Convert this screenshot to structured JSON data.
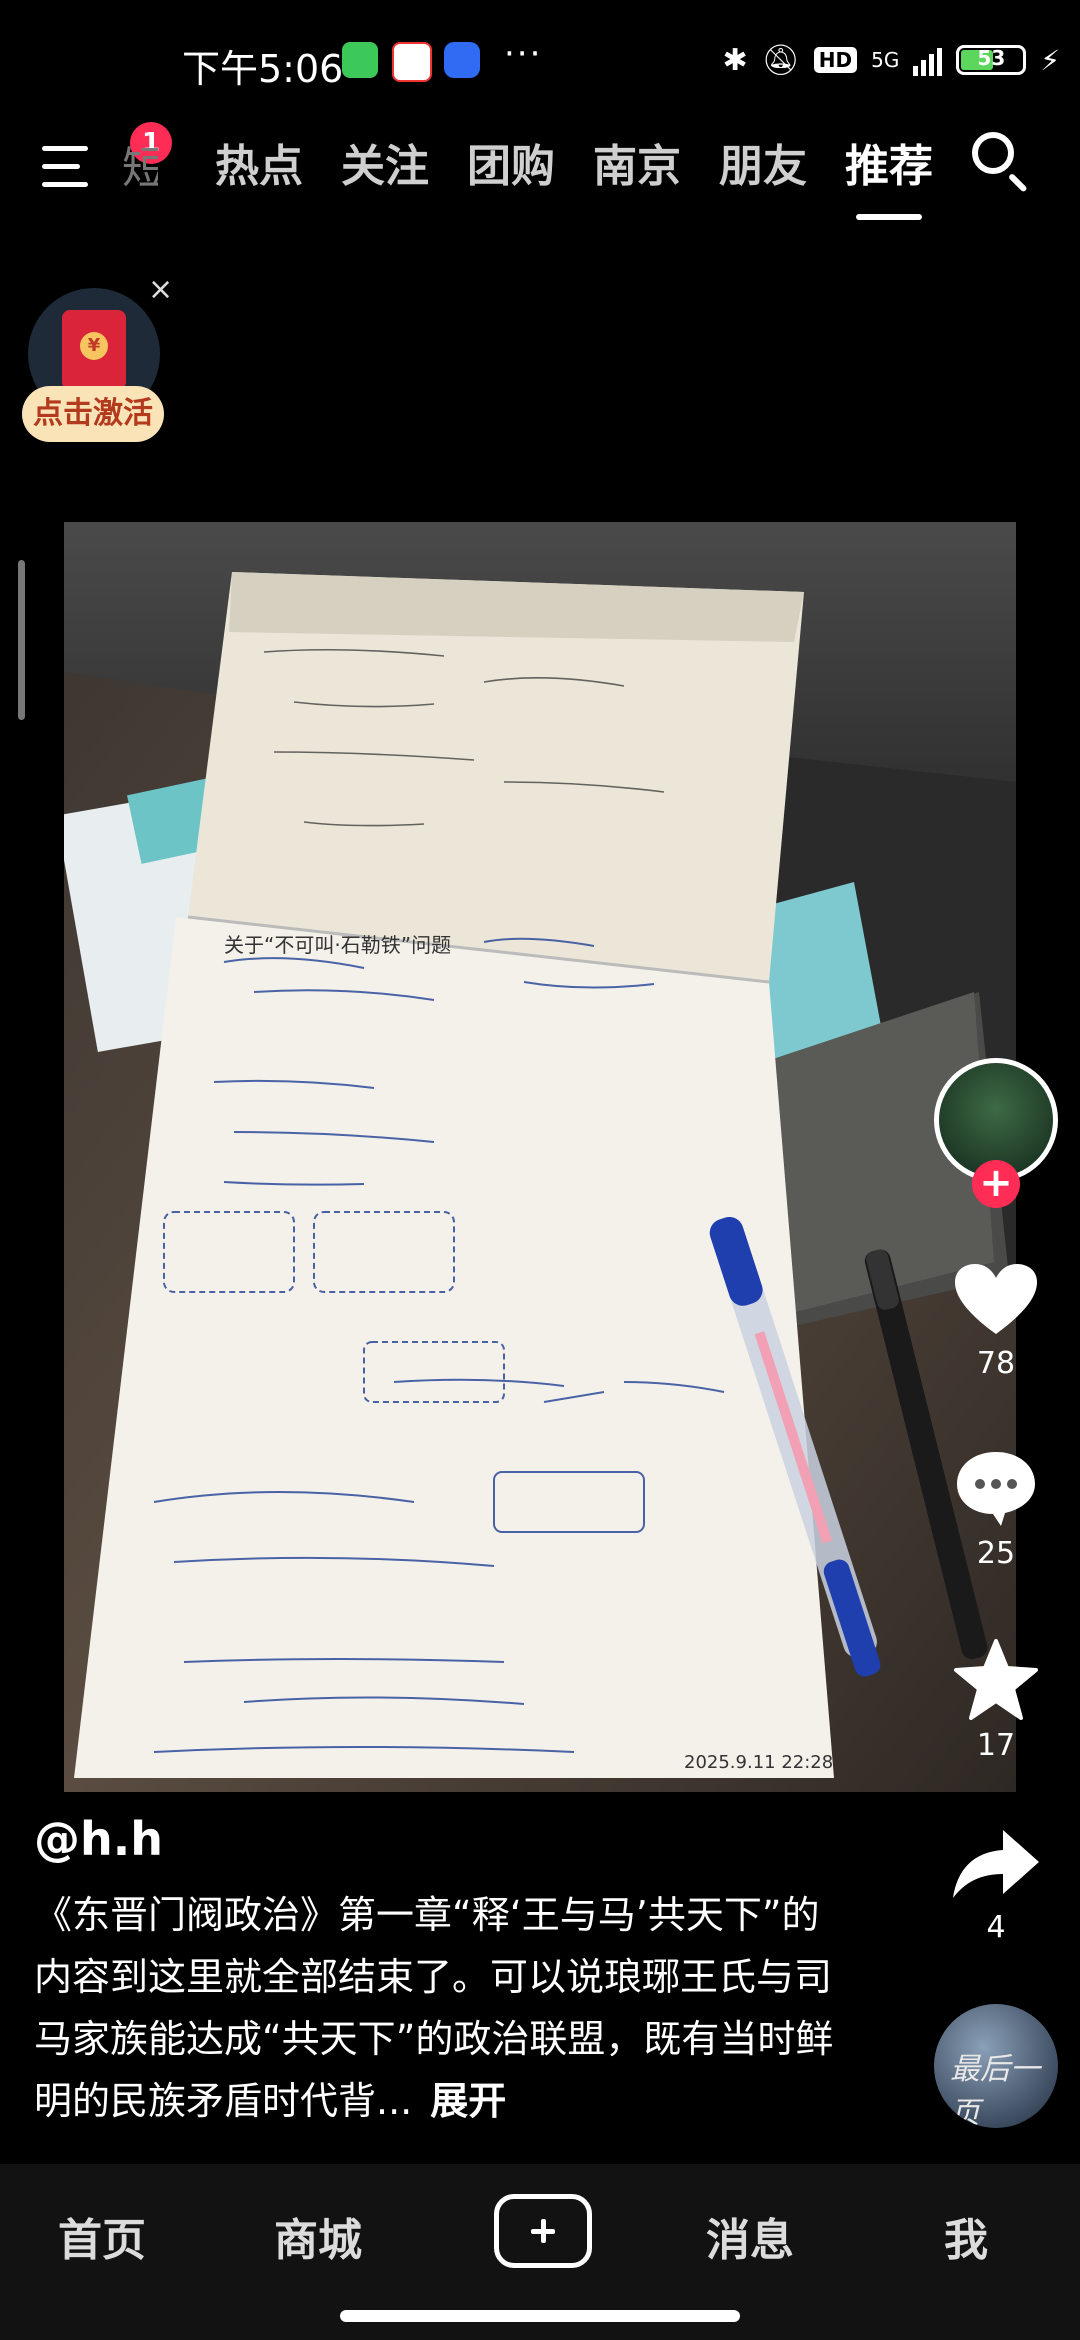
{
  "status_bar": {
    "time": "下午5:06",
    "more_dots": "···",
    "network": "5G",
    "hd": "HD",
    "battery": "53",
    "battery_level_percent": 53,
    "icons": [
      "wechat-icon",
      "58-app-icon",
      "baidu-netdisk-icon",
      "bluetooth-icon",
      "bell-muted-icon",
      "signal-icon",
      "charging-icon"
    ]
  },
  "top_nav": {
    "menu_badge": "1",
    "partial_tab": "短",
    "tabs": [
      {
        "label": "热点",
        "active": false
      },
      {
        "label": "关注",
        "active": false
      },
      {
        "label": "团购",
        "active": false
      },
      {
        "label": "南京",
        "active": false
      },
      {
        "label": "朋友",
        "active": false
      },
      {
        "label": "推荐",
        "active": true
      }
    ]
  },
  "red_envelope": {
    "close_label": "×",
    "button_label": "点击激活"
  },
  "photo": {
    "header_note": "关于“不可叫·石勒铁”问题",
    "date_note": "2025.9.11 22:28"
  },
  "actions": {
    "like_count": "78",
    "comment_count": "25",
    "favorite_count": "17",
    "share_count": "4",
    "follow_label": "+",
    "author_avatar_text": "最后一页"
  },
  "post": {
    "username": "@h.h",
    "caption": "《东晋门阀政治》第一章“释‘王与马’共天下”的内容到这里就全部结束了。可以说琅琊王氏与司马家族能达成“共天下”的政治联盟，既有当时鲜明的民族矛盾时代背...",
    "expand_label": "展开"
  },
  "bottom_nav": {
    "items": [
      "首页",
      "商城",
      "消息",
      "我"
    ]
  },
  "colors": {
    "accent": "#ff2c55",
    "background": "#000000",
    "bottom_nav_bg": "#121212"
  }
}
